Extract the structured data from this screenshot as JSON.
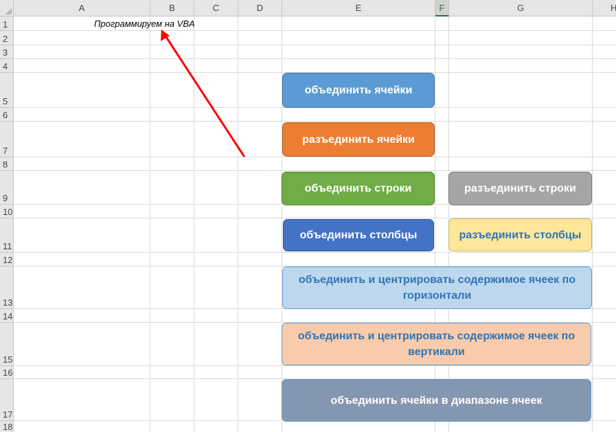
{
  "spreadsheet": {
    "columns": [
      "A",
      "B",
      "C",
      "D",
      "E",
      "F",
      "G",
      "H"
    ],
    "selected_column": "F",
    "rows": [
      "1",
      "2",
      "3",
      "4",
      "5",
      "6",
      "7",
      "8",
      "9",
      "10",
      "11",
      "12",
      "13",
      "14",
      "15",
      "16",
      "17",
      "18"
    ],
    "cell_b1": "Программируем на VBA"
  },
  "buttons": [
    {
      "label": "объединить ячейки",
      "fill": "#5b9bd5",
      "border": "#41719c",
      "text": "#ffffff"
    },
    {
      "label": "разъединить ячейки",
      "fill": "#ed7d31",
      "border": "#ae5a21",
      "text": "#ffffff"
    },
    {
      "label": "объединить строки",
      "fill": "#70ad47",
      "border": "#507e32",
      "text": "#ffffff"
    },
    {
      "label": "разъединить строки",
      "fill": "#a5a5a5",
      "border": "#787878",
      "text": "#ffffff"
    },
    {
      "label": "объединить столбцы",
      "fill": "#4472c4",
      "border": "#2f528f",
      "text": "#ffffff"
    },
    {
      "label": "разъединить столбцы",
      "fill": "#ffe699",
      "border": "#c9b458",
      "text": "#2e75b6"
    },
    {
      "label": "объединить и центрировать содержимое ячеек по горизонтали",
      "fill": "#bdd7ee",
      "border": "#5b9bd5",
      "text": "#2e75b6"
    },
    {
      "label": "объединить и центрировать содержимое ячеек по вертикали",
      "fill": "#f8cbad",
      "border": "#5b9bd5",
      "text": "#2e75b6"
    },
    {
      "label": "объединить ячейки в диапазоне ячеек",
      "fill": "#8497b0",
      "border": "#5b9bd5",
      "text": "#ffffff"
    }
  ],
  "annotation": {
    "arrow_color": "#ff0000"
  }
}
